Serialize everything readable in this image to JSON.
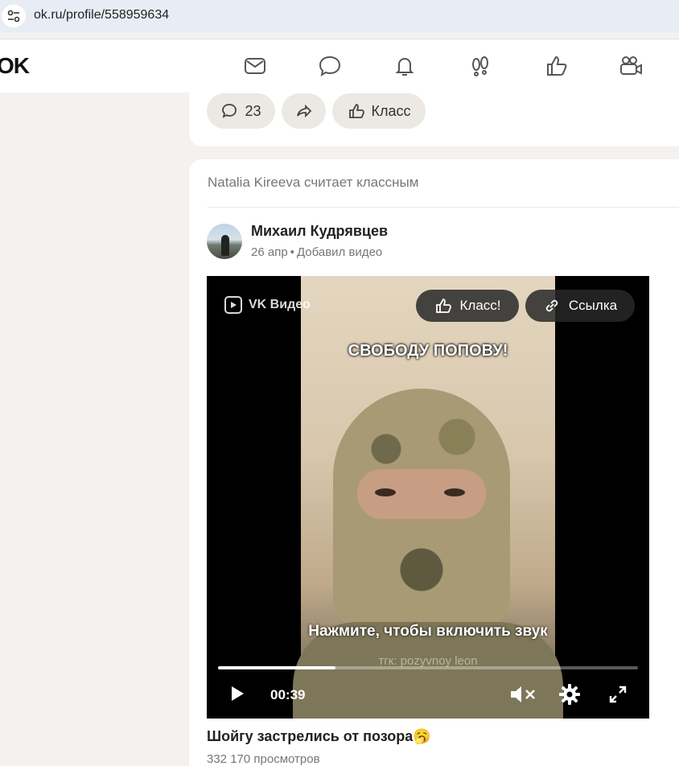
{
  "browser": {
    "url": "ok.ru/profile/558959634"
  },
  "header": {
    "logo": "OK",
    "nav_icons": [
      "mail-icon",
      "chat-icon",
      "bell-icon",
      "guests-icon",
      "likes-icon",
      "video-icon"
    ]
  },
  "prev_post_actions": {
    "comments_count": "23",
    "class_label": "Класс"
  },
  "post": {
    "liked_by": "Natalia Kireeva считает классным",
    "author": "Михаил Кудрявцев",
    "date": "26 апр",
    "separator": "•",
    "action": "Добавил видео",
    "video": {
      "brand": "VK Видео",
      "class_button": "Класс!",
      "link_button": "Ссылка",
      "caption": "СВОБОДУ ПОПОВУ!",
      "tap_for_sound": "Нажмите, чтобы включить звук",
      "watermark": "тгк: pozyvnoy leon",
      "time": "00:39",
      "progress": 0.28
    },
    "title": "Шойгу застрелись от позора",
    "title_emoji": "🥱",
    "views": "332 170 просмотров"
  },
  "colors": {
    "page_bg": "#f4f1ee",
    "card_bg": "#ffffff",
    "pill_bg": "#ece8e4",
    "address_bar": "#e8edf5"
  }
}
